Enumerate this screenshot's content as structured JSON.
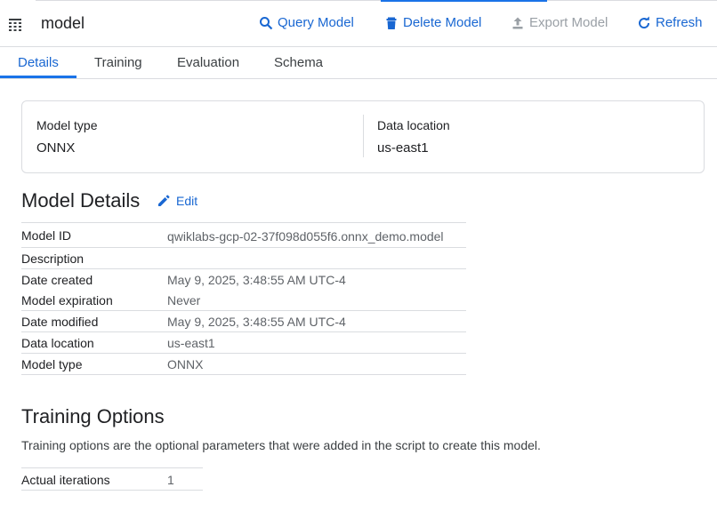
{
  "header": {
    "title": "model",
    "buttons": {
      "query": "Query Model",
      "delete": "Delete Model",
      "export": "Export Model",
      "refresh": "Refresh"
    }
  },
  "tabs": [
    "Details",
    "Training",
    "Evaluation",
    "Schema"
  ],
  "active_tab": "Details",
  "summary": {
    "model_type_label": "Model type",
    "model_type_value": "ONNX",
    "data_location_label": "Data location",
    "data_location_value": "us-east1"
  },
  "model_details": {
    "title": "Model Details",
    "edit_label": "Edit",
    "rows": [
      {
        "key": "Model ID",
        "value": "qwiklabs-gcp-02-37f098d055f6.onnx_demo.model"
      },
      {
        "key": "Description",
        "value": ""
      },
      {
        "key": "Date created",
        "value": "May 9, 2025, 3:48:55 AM UTC-4"
      },
      {
        "key": "Model expiration",
        "value": "Never"
      },
      {
        "key": "Date modified",
        "value": "May 9, 2025, 3:48:55 AM UTC-4"
      },
      {
        "key": "Data location",
        "value": "us-east1"
      },
      {
        "key": "Model type",
        "value": "ONNX"
      }
    ]
  },
  "training_options": {
    "title": "Training Options",
    "description": "Training options are the optional parameters that were added in the script to create this model.",
    "rows": [
      {
        "key": "Actual iterations",
        "value": "1"
      }
    ]
  },
  "colors": {
    "accent": "#1a73e8",
    "link": "#1967d2",
    "disabled": "#9aa0a6",
    "divider": "#dadce0"
  }
}
